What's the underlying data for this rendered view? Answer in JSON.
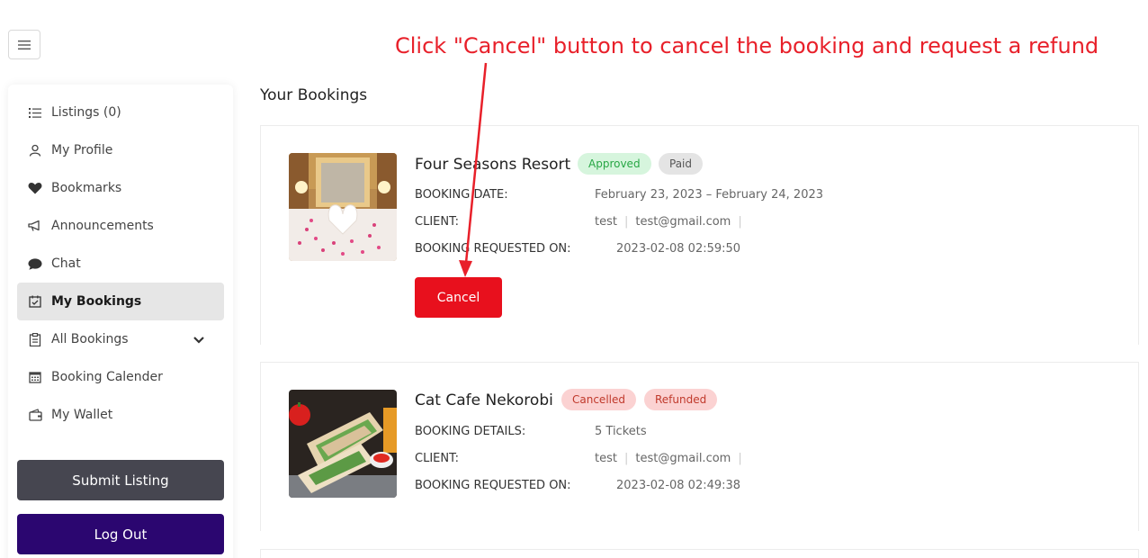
{
  "annotation": {
    "text": "Click \"Cancel\" button to cancel the booking and request a refund",
    "color": "#e8202a"
  },
  "sidebar": {
    "items": [
      {
        "label": "Listings (0)",
        "icon": "list-icon"
      },
      {
        "label": "My Profile",
        "icon": "user-icon"
      },
      {
        "label": "Bookmarks",
        "icon": "heart-icon"
      },
      {
        "label": "Announcements",
        "icon": "megaphone-icon"
      },
      {
        "label": "Chat",
        "icon": "chat-icon"
      },
      {
        "label": "My Bookings",
        "icon": "calendar-check-icon"
      },
      {
        "label": "All Bookings",
        "icon": "clipboard-icon"
      },
      {
        "label": "Booking Calender",
        "icon": "calendar-icon"
      },
      {
        "label": "My Wallet",
        "icon": "wallet-icon"
      }
    ],
    "submit_label": "Submit Listing",
    "logout_label": "Log Out"
  },
  "main": {
    "title": "Your Bookings",
    "bookings": [
      {
        "title": "Four Seasons Resort",
        "status": "Approved",
        "payment": "Paid",
        "row1_label": "Booking Date:",
        "row1_value": "February 23, 2023 – February 24, 2023",
        "client_label": "Client:",
        "client_name": "test",
        "client_email": "test@gmail.com",
        "requested_label": "Booking Requested On:",
        "requested_value": "2023-02-08 02:59:50",
        "cancel_label": "Cancel"
      },
      {
        "title": "Cat Cafe Nekorobi",
        "status": "Cancelled",
        "payment": "Refunded",
        "row1_label": "Booking Details:",
        "row1_value": "5 Tickets",
        "client_label": "Client:",
        "client_name": "test",
        "client_email": "test@gmail.com",
        "requested_label": "Booking Requested On:",
        "requested_value": "2023-02-08 02:49:38"
      }
    ]
  }
}
